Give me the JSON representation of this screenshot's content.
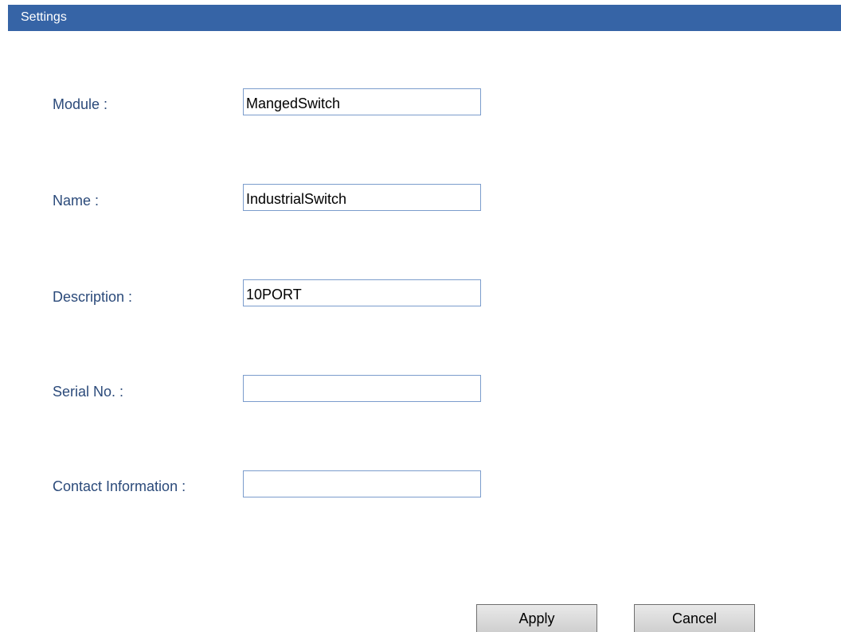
{
  "header": {
    "title": "Settings",
    "color": "#3664a6"
  },
  "form": {
    "fields": [
      {
        "label": "Module :",
        "value": "MangedSwitch"
      },
      {
        "label": "Name :",
        "value": "IndustrialSwitch"
      },
      {
        "label": "Description :",
        "value": "10PORT"
      },
      {
        "label": "Serial No. :",
        "value": ""
      },
      {
        "label": "Contact Information :",
        "value": ""
      }
    ]
  },
  "buttons": {
    "apply_label": "Apply",
    "cancel_label": "Cancel"
  }
}
